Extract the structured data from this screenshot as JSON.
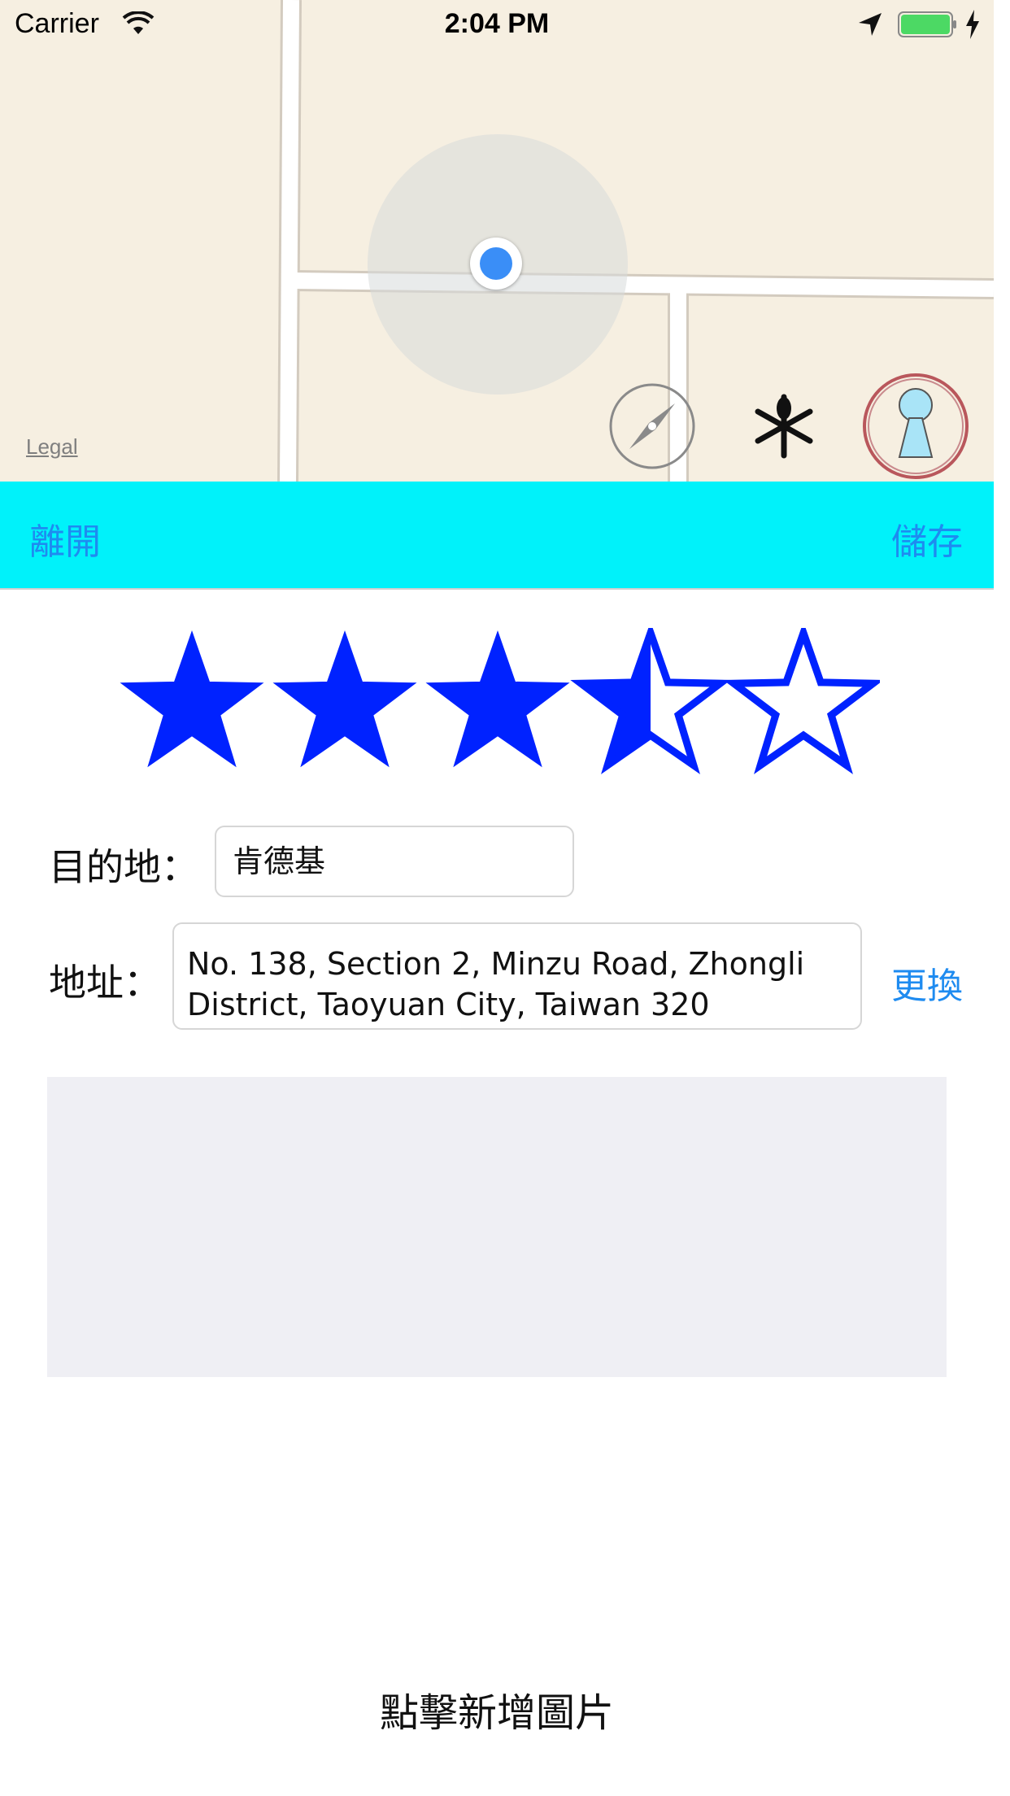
{
  "status_bar": {
    "carrier": "Carrier",
    "time": "2:04 PM",
    "icons": [
      "wifi-icon",
      "location-arrow-icon",
      "battery-icon",
      "charging-bolt-icon"
    ],
    "battery_color": "#4cd964"
  },
  "map": {
    "legal": "Legal",
    "buttons": [
      "compass-icon",
      "restaurant-icon",
      "person-marker-icon"
    ],
    "user_location_color": "#3a8ef7"
  },
  "toolbar": {
    "leave_label": "離開",
    "save_label": "儲存",
    "background": "#00f2fa",
    "text_color": "#1e8bf0"
  },
  "rating": {
    "value": 3.5,
    "max": 5,
    "star_color": "#0022ff"
  },
  "form": {
    "destination_label": "目的地：",
    "destination_value": "肯德基",
    "address_label": "地址：",
    "address_value": "No. 138, Section 2, Minzu Road, Zhongli District, Taoyuan City, Taiwan 320",
    "change_label": "更換"
  },
  "photo": {
    "add_label": "點擊新增圖片"
  }
}
